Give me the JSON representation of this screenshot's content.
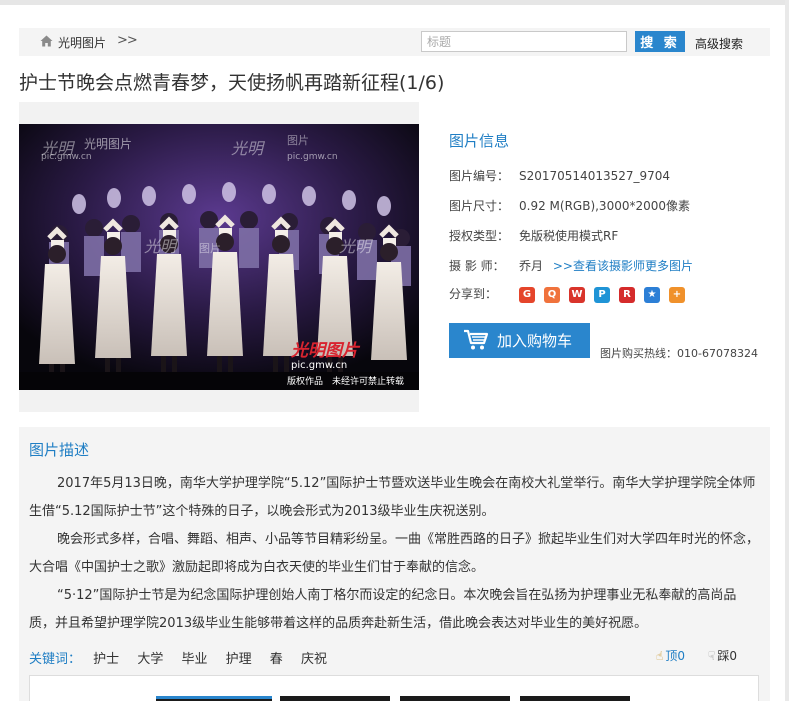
{
  "breadcrumb": {
    "home_icon": "home-icon",
    "site": "光明图片",
    "separator": ">>"
  },
  "search": {
    "placeholder": "标题",
    "button": "搜 索",
    "advanced": "高级搜索"
  },
  "page_title": "护士节晚会点燃青春梦，天使扬帆再踏新征程(1/6)",
  "photo": {
    "watermark_logo": "光明图片",
    "watermark_url": "pic.gmw.cn",
    "copyright": "版权作品　未经许可禁止转载"
  },
  "info": {
    "title": "图片信息",
    "rows": [
      {
        "k": "图片编号：",
        "v": "S20170514013527_9704"
      },
      {
        "k": "图片尺寸：",
        "v": "0.92 M(RGB),3000*2000像素"
      },
      {
        "k": "授权类型：",
        "v": "免版税使用模式RF"
      }
    ],
    "photographer_label": "摄 影 师：",
    "photographer": "乔月",
    "photographer_link": ">>查看该摄影师更多图片",
    "share_label": "分享到：",
    "share_icons": [
      {
        "name": "google-share-icon",
        "glyph": "G",
        "color": "#e5452b"
      },
      {
        "name": "weibo-qq-share-icon",
        "glyph": "Q",
        "color": "#f0723c"
      },
      {
        "name": "sina-weibo-share-icon",
        "glyph": "W",
        "color": "#d9342b"
      },
      {
        "name": "qzone-share-icon",
        "glyph": "P",
        "color": "#1f94d6"
      },
      {
        "name": "renren-share-icon",
        "glyph": "R",
        "color": "#d52b2b"
      },
      {
        "name": "star-share-icon",
        "glyph": "★",
        "color": "#2c7fd6"
      },
      {
        "name": "bookmark-share-icon",
        "glyph": "+",
        "color": "#f0912b"
      }
    ],
    "cart_button": "加入购物车",
    "hotline": "图片购买热线：010-67078324"
  },
  "description": {
    "title": "图片描述",
    "paragraphs": [
      "2017年5月13日晚，南华大学护理学院“5.12”国际护士节暨欢送毕业生晚会在南校大礼堂举行。南华大学护理学院全体师生借“5.12国际护士节”这个特殊的日子，以晚会形式为2013级毕业生庆祝送别。",
      "晚会形式多样，合唱、舞蹈、相声、小品等节目精彩纷呈。一曲《常胜西路的日子》掀起毕业生们对大学四年时光的怀念，大合唱《中国护士之歌》激励起即将成为白衣天使的毕业生们甘于奉献的信念。",
      "“5·12”国际护士节是为纪念国际护理创始人南丁格尔而设定的纪念日。本次晚会旨在弘扬为护理事业无私奉献的高尚品质，并且希望护理学院2013级毕业生能够带着这样的品质奔赴新生活，借此晚会表达对毕业生的美好祝愿。"
    ],
    "keywords_label": "关键词：",
    "keywords": [
      "护士",
      "大学",
      "毕业",
      "护理",
      "春",
      "庆祝"
    ],
    "vote_up": "顶0",
    "vote_down": "踩0"
  },
  "colors": {
    "accent": "#2a86cd",
    "link": "#1f7ec4"
  }
}
